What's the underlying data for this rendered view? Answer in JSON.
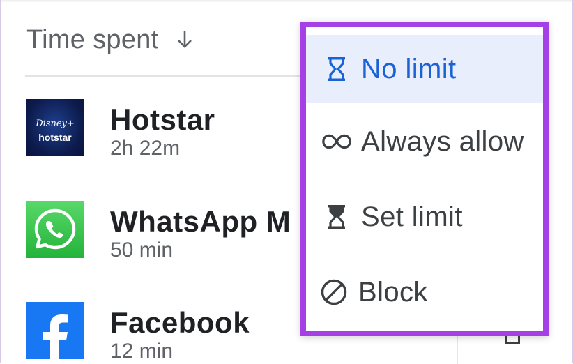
{
  "sort": {
    "label": "Time spent",
    "direction_icon": "arrow-down-icon"
  },
  "apps": [
    {
      "name": "Hotstar",
      "time": "2h 22m",
      "icon": "hotstar-logo",
      "logo_top": "Disney+",
      "logo_bottom": "hotstar"
    },
    {
      "name": "WhatsApp M",
      "time": "50 min",
      "icon": "whatsapp-logo"
    },
    {
      "name": "Facebook",
      "time": "12 min",
      "icon": "facebook-logo"
    }
  ],
  "menu": {
    "items": [
      {
        "label": "No limit",
        "icon": "hourglass-empty-icon",
        "selected": true
      },
      {
        "label": "Always allow",
        "icon": "infinity-icon",
        "selected": false
      },
      {
        "label": "Set limit",
        "icon": "hourglass-filled-icon",
        "selected": false
      },
      {
        "label": "Block",
        "icon": "block-icon",
        "selected": false
      }
    ],
    "highlight_color": "#a53fe6",
    "selected_color": "#1a63d6",
    "selected_bg": "#e8eefb"
  }
}
